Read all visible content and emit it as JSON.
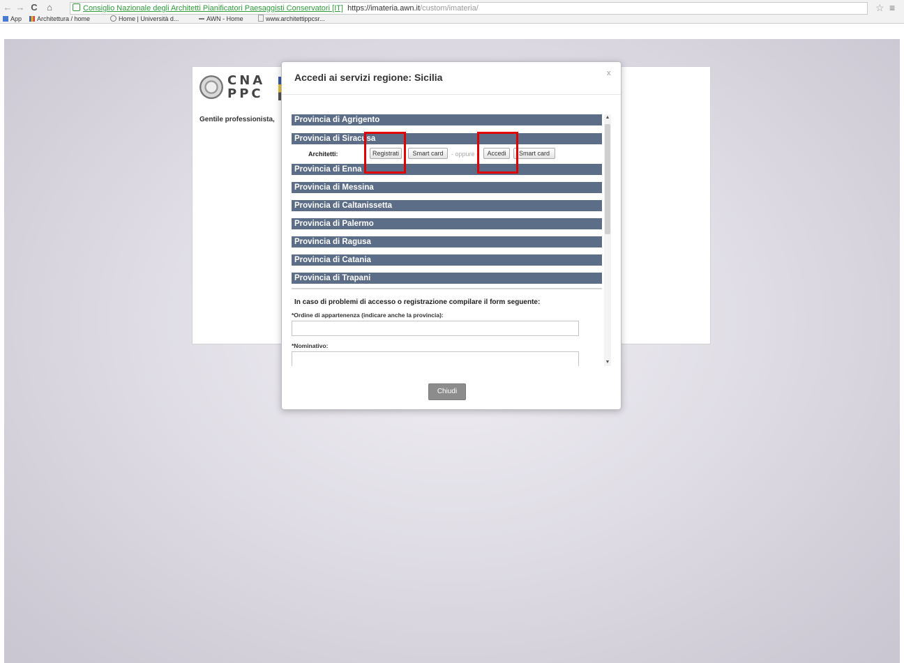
{
  "browser": {
    "nav": {
      "back": "←",
      "forward": "→",
      "reload": "C",
      "home": "⌂"
    },
    "ev_badge": "Consiglio Nazionale degli Architetti Pianificatori Paesaggisti Conservatori [IT]",
    "url_host": "https://imateria.awn.it",
    "url_path": "/custom/imateria/",
    "star": "☆",
    "menu": "≡"
  },
  "bookmarks": [
    {
      "label": "App",
      "icon": "apps-grid-icon",
      "color": "#4a7bd0"
    },
    {
      "label": "Architettura / home",
      "icon": "colorful-bars-icon",
      "color": "#e1b328"
    },
    {
      "label": "Home | Università d...",
      "icon": "university-icon",
      "color": "#777777"
    },
    {
      "label": "AWN - Home",
      "icon": "awn-icon",
      "color": "#777777"
    },
    {
      "label": "www.architettippcsr...",
      "icon": "page-icon",
      "color": "#999999"
    }
  ],
  "background_page": {
    "logo_line1": "CNA",
    "logo_line2": "PPC",
    "greeting": "Gentile professionista,"
  },
  "modal": {
    "title": "Accedi ai servizi regione: Sicilia",
    "close": "x",
    "provinces": [
      "Provincia di Agrigento",
      "Provincia di Siracusa",
      "Provincia di Enna",
      "Provincia di Messina",
      "Provincia di Caltanissetta",
      "Provincia di Palermo",
      "Provincia di Ragusa",
      "Provincia di Catania",
      "Provincia di Trapani"
    ],
    "architetti": {
      "label": "Architetti:",
      "registrati": "Registrati",
      "smart_card_1": "Smart card",
      "oppure": "- oppure -",
      "accedi": "Accedi",
      "smart_card_2": "Smart card"
    },
    "form": {
      "title": "In caso di problemi di accesso o registrazione compilare il form seguente:",
      "ordine_label": "*Ordine di appartenenza (indicare anche la provincia):",
      "nominativo_label": "*Nominativo:"
    },
    "close_button": "Chiudi",
    "highlight_color": "#e00000"
  }
}
